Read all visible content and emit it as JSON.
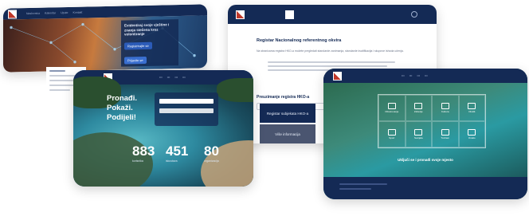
{
  "card1": {
    "nav": [
      "Naslovnica",
      "Kalendar",
      "Upute",
      "Kontakt"
    ],
    "hero_title": "Evidentiraj svoje vještine i znanja stečena kroz volontiranje",
    "btn1": "Registrirajte se",
    "btn2": "Prijavite se"
  },
  "card2": {
    "heading": "Registar Nacionalnog referentnog okvira",
    "paragraph": "Na stranicama registra HKO-a možete pregledati standarde zanimanja, standarde kvalifikacija i skupove ishoda učenja.",
    "section_title": "Preuzimanje registra HKO-a",
    "btn_register": "Registar subjekata HKO-a",
    "btn_more": "Više informacija"
  },
  "card3": {
    "hero": [
      "Pronađi.",
      "Pokaži.",
      "Podijeli!"
    ],
    "stats": [
      {
        "value": "883",
        "label": "korisnika"
      },
      {
        "value": "451",
        "label": "iskustava"
      },
      {
        "value": "80",
        "label": "organizacija"
      }
    ]
  },
  "card4": {
    "tiles": [
      "Obrazovanje",
      "Zdravlje",
      "Kultura",
      "Okoliš",
      "Sport",
      "Socijala",
      "Turizam",
      "Ostalo"
    ],
    "tagline": "Uključi se i pronađi svoje mjesto"
  }
}
